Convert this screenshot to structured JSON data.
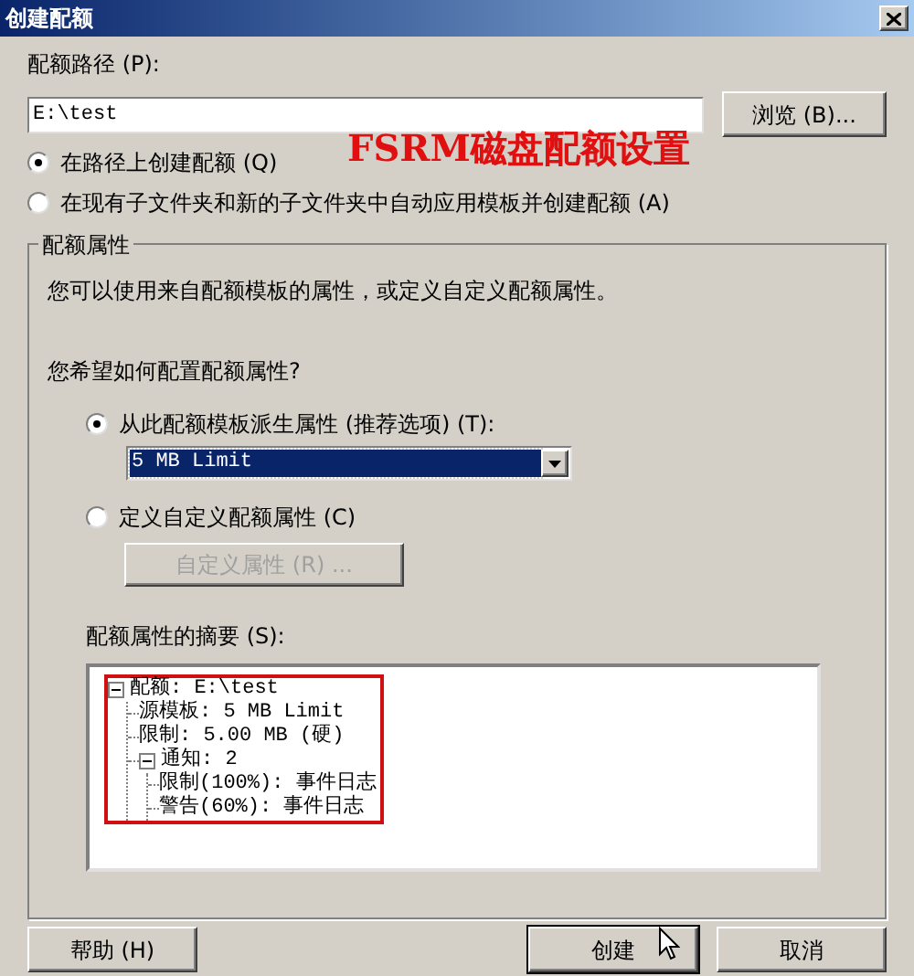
{
  "window": {
    "title": "创建配额"
  },
  "annotation": "FSRM磁盘配额设置",
  "path": {
    "label": "配额路径 (P):",
    "value": "E:\\test",
    "browse_button": "浏览 (B)..."
  },
  "create_options": [
    {
      "label": "在路径上创建配额 (Q)",
      "selected": true
    },
    {
      "label": "在现有子文件夹和新的子文件夹中自动应用模板并创建配额 (A)",
      "selected": false
    }
  ],
  "properties_group": {
    "title": "配额属性",
    "description": "您可以使用来自配额模板的属性，或定义自定义配额属性。",
    "question": "您希望如何配置配额属性?",
    "options": [
      {
        "kind": "template",
        "label": "从此配额模板派生属性 (推荐选项) (T):",
        "selected": true,
        "dropdown": {
          "value": "5 MB Limit",
          "focused": true
        }
      },
      {
        "kind": "custom",
        "label": "定义自定义配额属性 (C)",
        "selected": false,
        "button": {
          "label": "自定义属性 (R) ...",
          "disabled": true
        }
      }
    ],
    "summary_label": "配额属性的摘要 (S):",
    "summary_tree": [
      {
        "label": "配额: E:\\test",
        "expanded": true,
        "children": [
          {
            "label": "源模板: 5 MB Limit"
          },
          {
            "label": "限制: 5.00 MB (硬)"
          },
          {
            "label": "通知: 2",
            "expanded": true,
            "children": [
              {
                "label": "限制(100%): 事件日志"
              },
              {
                "label": "警告(60%): 事件日志"
              }
            ]
          }
        ]
      }
    ]
  },
  "buttons": [
    {
      "label": "帮助 (H)",
      "default": false
    },
    {
      "label": "创建",
      "default": true
    },
    {
      "label": "取消",
      "default": false
    }
  ]
}
